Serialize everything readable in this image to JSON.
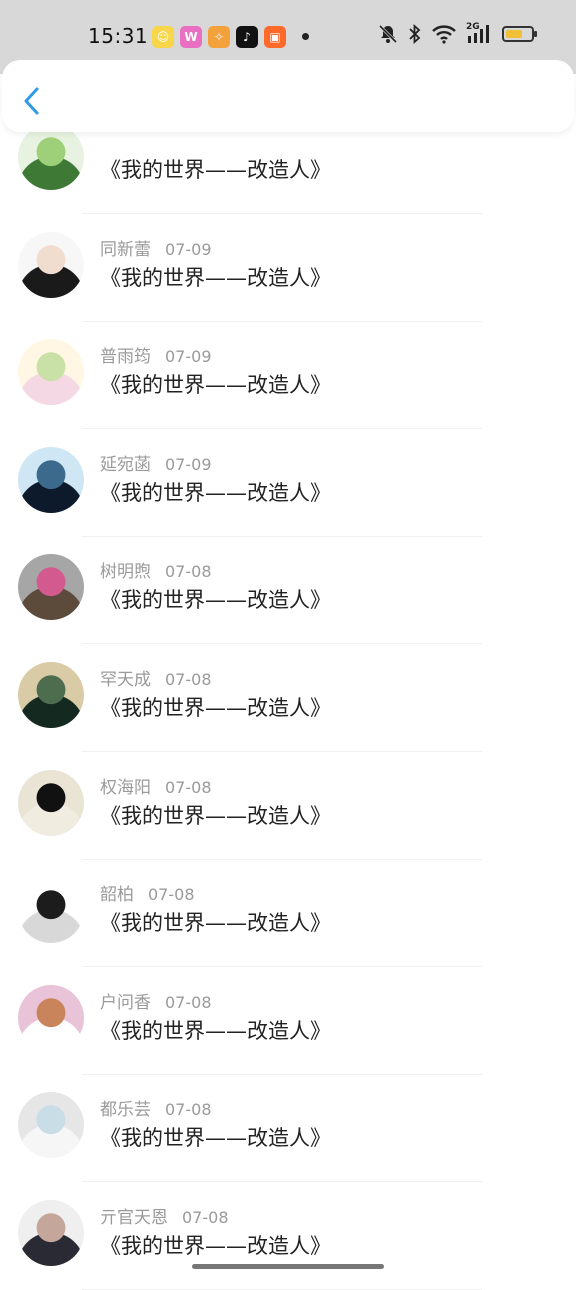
{
  "status_bar": {
    "time": "15:31",
    "app_icons": [
      {
        "name": "app-icon-1",
        "color": "#f7d64a",
        "glyph": "☺"
      },
      {
        "name": "app-icon-2",
        "color": "#e86fc1",
        "glyph": "W"
      },
      {
        "name": "app-icon-3",
        "color": "#f3a23b",
        "glyph": "✧"
      },
      {
        "name": "douyin-icon",
        "color": "#111111",
        "glyph": "♪"
      },
      {
        "name": "app-icon-5",
        "color": "#ff6a2b",
        "glyph": "▣"
      }
    ],
    "signal_label": "2G",
    "battery_color": "#f2c037"
  },
  "header": {
    "back_color": "#2f9be8"
  },
  "rows": [
    {
      "name": "",
      "date": "",
      "message": "《我的世界——改造人》",
      "avatar": [
        "#3e7a36",
        "#9ed07a",
        "#e8f2e0"
      ]
    },
    {
      "name": "同新蕾",
      "date": "07-09",
      "message": "《我的世界——改造人》",
      "avatar": [
        "#1a1a1a",
        "#f1dcd0",
        "#f7f7f7"
      ]
    },
    {
      "name": "普雨筠",
      "date": "07-09",
      "message": "《我的世界——改造人》",
      "avatar": [
        "#f4d8e4",
        "#c9e0a6",
        "#fff7e4"
      ]
    },
    {
      "name": "延宛菡",
      "date": "07-09",
      "message": "《我的世界——改造人》",
      "avatar": [
        "#0c1a2c",
        "#3b6a8c",
        "#cfe6f4"
      ]
    },
    {
      "name": "树明煦",
      "date": "07-08",
      "message": "《我的世界——改造人》",
      "avatar": [
        "#5c4a3a",
        "#d25a8e",
        "#a6a6a6"
      ]
    },
    {
      "name": "罕天成",
      "date": "07-08",
      "message": "《我的世界——改造人》",
      "avatar": [
        "#142a20",
        "#4e6d4e",
        "#d9cba6"
      ]
    },
    {
      "name": "权海阳",
      "date": "07-08",
      "message": "《我的世界——改造人》",
      "avatar": [
        "#f0ece0",
        "#111111",
        "#e9e4d4"
      ]
    },
    {
      "name": "韶柏",
      "date": "07-08",
      "message": "《我的世界——改造人》",
      "avatar": [
        "#d8d8d8",
        "#1c1c1c",
        "#ffffff"
      ]
    },
    {
      "name": "户问香",
      "date": "07-08",
      "message": "《我的世界——改造人》",
      "avatar": [
        "#ffffff",
        "#c9845c",
        "#e9c3d8"
      ]
    },
    {
      "name": "都乐芸",
      "date": "07-08",
      "message": "《我的世界——改造人》",
      "avatar": [
        "#f6f6f6",
        "#c8dde6",
        "#e6e6e6"
      ]
    },
    {
      "name": "亓官天恩",
      "date": "07-08",
      "message": "《我的世界——改造人》",
      "avatar": [
        "#2a2a34",
        "#c4a69a",
        "#efefef"
      ]
    }
  ]
}
